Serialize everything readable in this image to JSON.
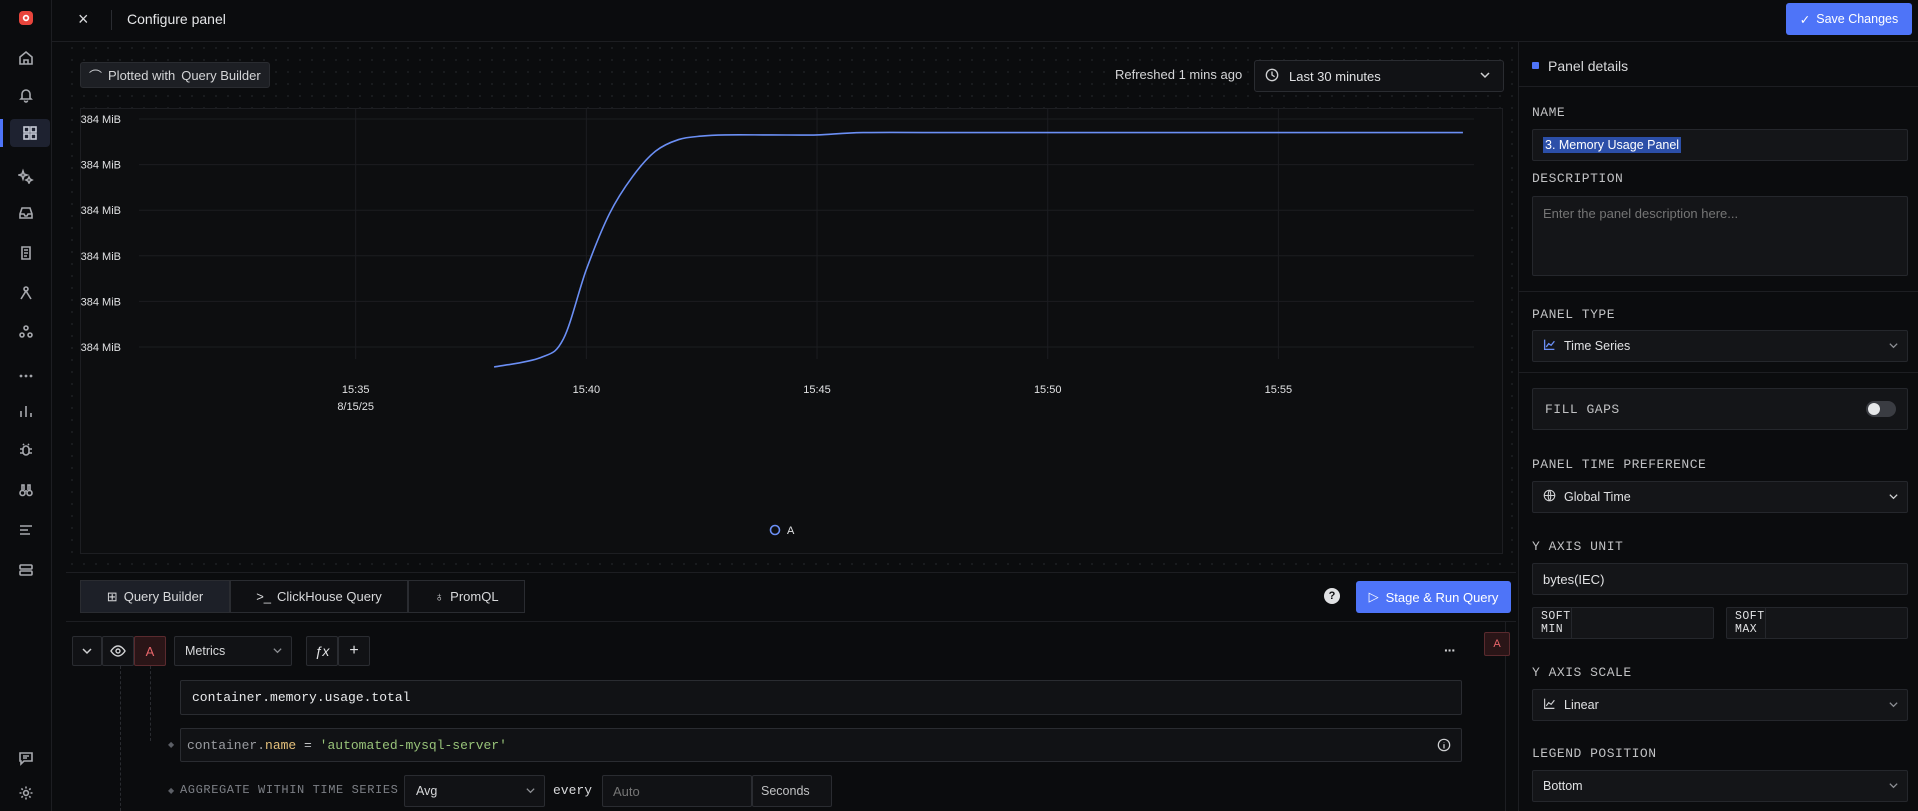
{
  "header": {
    "title": "Configure panel",
    "save_label": "Save Changes"
  },
  "toolbar": {
    "plotted_label": "Plotted with",
    "plotted_source": "Query Builder",
    "refreshed": "Refreshed 1 mins ago",
    "time_range": "Last 30 minutes"
  },
  "chart_data": {
    "type": "line",
    "y_tick_labels": [
      "384 MiB",
      "384 MiB",
      "384 MiB",
      "384 MiB",
      "384 MiB",
      "384 MiB"
    ],
    "x_tick_labels": [
      "15:35",
      "15:40",
      "15:45",
      "15:50",
      "15:55"
    ],
    "x_date_label": "8/15/25",
    "series": [
      {
        "name": "A",
        "color": "#6b8ff5",
        "x": [
          "15:38",
          "15:39",
          "15:39.5",
          "15:40",
          "15:40.5",
          "15:41",
          "15:41.5",
          "15:42",
          "15:42.5",
          "15:43",
          "15:44",
          "15:45",
          "15:46",
          "15:48",
          "15:50",
          "15:55",
          "15:59"
        ],
        "values": [
          0.0,
          0.04,
          0.12,
          0.42,
          0.66,
          0.82,
          0.93,
          0.98,
          0.995,
          1.0,
          1.0,
          1.0,
          1.01,
          1.01,
          1.01,
          1.01,
          1.01
        ]
      }
    ],
    "y_range": [
      0,
      1.06
    ],
    "x_range": [
      "15:30",
      "15:59.5"
    ],
    "grid": true,
    "legend_position": "bottom"
  },
  "query_tabs": [
    "Query Builder",
    "ClickHouse Query",
    "PromQL"
  ],
  "help": "?",
  "stage_label": "Stage & Run Query",
  "query": {
    "letter": "A",
    "source": "Metrics",
    "fx": "ƒx",
    "add": "+",
    "more": "···",
    "metric": "container.memory.usage.total",
    "filter_key_prefix": "container.",
    "filter_key": "name",
    "filter_op": "=",
    "filter_value": "'automated-mysql-server'",
    "aggregate_label": "AGGREGATE WITHIN TIME SERIES",
    "aggregate_value": "Avg",
    "every_label": "every",
    "every_placeholder": "Auto",
    "every_unit": "Seconds"
  },
  "panel": {
    "section_title": "Panel details",
    "name_label": "NAME",
    "name_value": "3. Memory Usage Panel",
    "description_label": "DESCRIPTION",
    "description_placeholder": "Enter the panel description here...",
    "panel_type_label": "PANEL TYPE",
    "panel_type_value": "Time Series",
    "fill_gaps_label": "FILL GAPS",
    "time_pref_label": "PANEL TIME PREFERENCE",
    "time_pref_value": "Global Time",
    "y_unit_label": "Y AXIS UNIT",
    "y_unit_value": "bytes(IEC)",
    "soft_min_label": "SOFT MIN",
    "soft_max_label": "SOFT MAX",
    "y_scale_label": "Y AXIS SCALE",
    "y_scale_value": "Linear",
    "legend_label": "LEGEND POSITION",
    "legend_value": "Bottom"
  }
}
